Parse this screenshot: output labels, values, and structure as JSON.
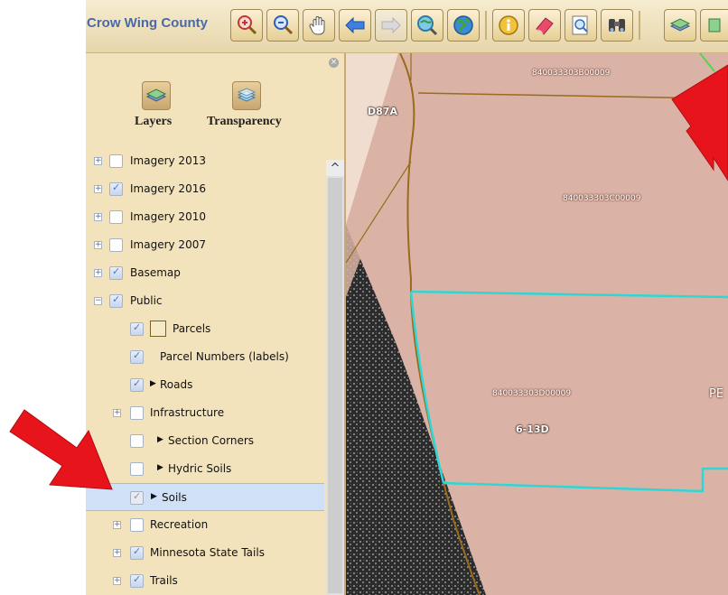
{
  "app": {
    "title": "Crow Wing County"
  },
  "toolbar": {
    "tools": [
      {
        "name": "zoom-in-tool",
        "icon": "zoom-in-icon"
      },
      {
        "name": "zoom-out-tool",
        "icon": "zoom-out-icon"
      },
      {
        "name": "pan-tool",
        "icon": "hand-icon"
      },
      {
        "name": "back-tool",
        "icon": "arrow-left-icon"
      },
      {
        "name": "forward-tool",
        "icon": "arrow-right-icon"
      },
      {
        "name": "zoom-full-tool",
        "icon": "magnifier-globe-icon"
      },
      {
        "name": "globe-tool",
        "icon": "globe-icon"
      },
      {
        "name": "identify-tool",
        "icon": "info-icon"
      },
      {
        "name": "clear-tool",
        "icon": "eraser-icon"
      },
      {
        "name": "search-tool",
        "icon": "search-document-icon"
      },
      {
        "name": "binoculars-tool",
        "icon": "binoculars-icon"
      },
      {
        "name": "layers-tool",
        "icon": "layers-icon"
      }
    ]
  },
  "sidebar": {
    "buttons": [
      {
        "label": "Layers",
        "icon": "layers-icon"
      },
      {
        "label": "Transparency",
        "icon": "transparency-icon"
      }
    ],
    "layers": [
      {
        "label": "Imagery 2013",
        "checked": false,
        "expander": "+"
      },
      {
        "label": "Imagery 2016",
        "checked": true,
        "expander": "+"
      },
      {
        "label": "Imagery 2010",
        "checked": false,
        "expander": "+"
      },
      {
        "label": "Imagery 2007",
        "checked": false,
        "expander": "+"
      },
      {
        "label": "Basemap",
        "checked": true,
        "expander": "+"
      },
      {
        "label": "Public",
        "checked": true,
        "expander": "−"
      },
      {
        "label": "Parcels",
        "checked": true
      },
      {
        "label": "Parcel Numbers (labels)",
        "checked": true
      },
      {
        "label": "Roads",
        "checked": true
      },
      {
        "label": "Infrastructure",
        "checked": false,
        "expander": "+"
      },
      {
        "label": "Section Corners",
        "checked": false
      },
      {
        "label": "Hydric Soils",
        "checked": false
      },
      {
        "label": "Soils",
        "checked": true
      },
      {
        "label": "Recreation",
        "checked": false,
        "expander": "+"
      },
      {
        "label": "Minnesota State Tails",
        "checked": true,
        "expander": "+"
      },
      {
        "label": "Trails",
        "checked": true,
        "expander": "+"
      }
    ]
  },
  "map": {
    "parcels": {
      "top": "840033303B00009",
      "middle": "840033303C00009",
      "lower": "840033303D00009"
    },
    "soils": {
      "upper": "D87A",
      "lower": "6-13D"
    },
    "owner_fragment": "PE",
    "colors": {
      "parcel_fill": "#dbb3a6",
      "parcel_outline": "#9a6b1c",
      "highlight": "#2fd6d6",
      "imagery": "#2e2e2e"
    }
  },
  "annotations": {
    "arrow_color": "#e8141b"
  }
}
